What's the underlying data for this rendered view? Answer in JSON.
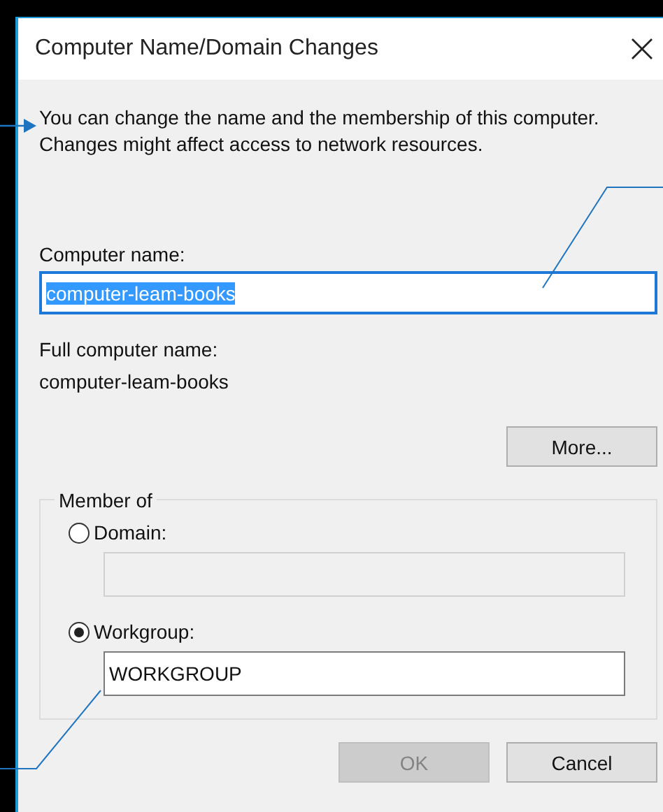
{
  "window": {
    "title": "Computer Name/Domain Changes"
  },
  "intro": "You can change the name and the membership of this computer. Changes might affect access to network resources.",
  "computer_name": {
    "label": "Computer name:",
    "value": "computer-leam-books",
    "text_selected": true
  },
  "full_computer_name": {
    "label": "Full computer name:",
    "value": "computer-leam-books"
  },
  "more_button": {
    "label": "More..."
  },
  "member_of": {
    "legend": "Member of",
    "options": [
      {
        "label": "Domain:",
        "selected": false,
        "field_disabled": true
      },
      {
        "label": "Workgroup:",
        "selected": true,
        "value": "WORKGROUP",
        "field_disabled": false
      }
    ]
  },
  "buttons": [
    {
      "label": "OK",
      "disabled": true
    },
    {
      "label": "Cancel",
      "disabled": false
    }
  ]
}
